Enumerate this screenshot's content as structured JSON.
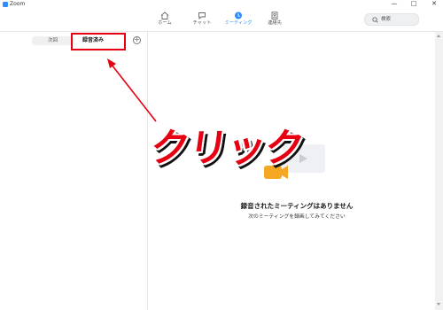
{
  "window": {
    "title": "Zoom",
    "minimize": "—",
    "maximize": "□",
    "close": "✕"
  },
  "toolbar": {
    "tabs": [
      {
        "label": "ホーム",
        "icon": "home-icon"
      },
      {
        "label": "チャット",
        "icon": "chat-icon"
      },
      {
        "label": "ミーティング",
        "icon": "meeting-clock-icon",
        "active": true
      },
      {
        "label": "連絡先",
        "icon": "contacts-icon"
      }
    ],
    "search_label": "検索"
  },
  "meetings": {
    "tabs": [
      {
        "label": "次回"
      },
      {
        "label": "録音済み",
        "selected": true
      }
    ],
    "add_symbol": "+"
  },
  "empty_state": {
    "title": "録音されたミーティングはありません",
    "subtitle": "次のミーティングを録画してみてください"
  },
  "annotation": {
    "text": "クリック",
    "color": "#e60012"
  },
  "colors": {
    "accent": "#2D8CFF",
    "annotation": "#e60012",
    "illustration_orange": "#F5A623"
  }
}
